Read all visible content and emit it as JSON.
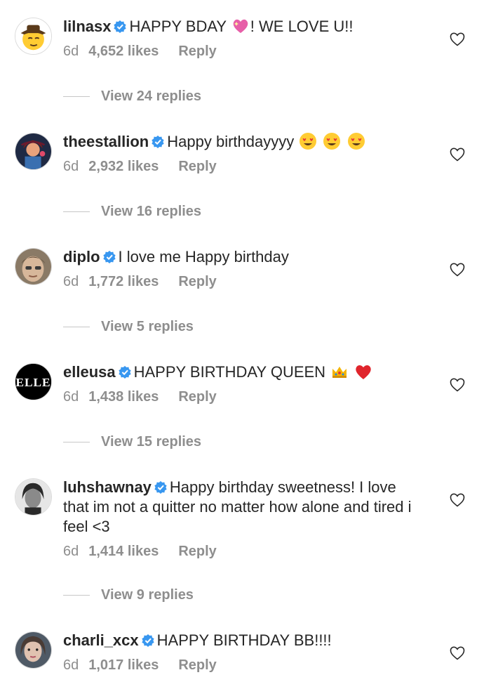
{
  "comments": [
    {
      "username": "lilnasx",
      "text": "HAPPY BDAY",
      "emoji_after": [
        "sparkling-heart"
      ],
      "text_tail": "! WE LOVE U!!",
      "time": "6d",
      "likes": "4,652 likes",
      "reply_label": "Reply",
      "replies_label": "View 24 replies"
    },
    {
      "username": "theestallion",
      "text": "Happy birthdayyyy",
      "emoji_after": [
        "heart-eyes",
        "heart-eyes",
        "heart-eyes"
      ],
      "text_tail": "",
      "time": "6d",
      "likes": "2,932 likes",
      "reply_label": "Reply",
      "replies_label": "View 16 replies"
    },
    {
      "username": "diplo",
      "text": "I love me Happy birthday",
      "emoji_after": [],
      "text_tail": "",
      "time": "6d",
      "likes": "1,772 likes",
      "reply_label": "Reply",
      "replies_label": "View 5 replies"
    },
    {
      "username": "elleusa",
      "text": "HAPPY BIRTHDAY QUEEN",
      "emoji_after": [
        "crown",
        "red-heart"
      ],
      "text_tail": "",
      "time": "6d",
      "likes": "1,438 likes",
      "reply_label": "Reply",
      "replies_label": "View 15 replies",
      "avatar_text": "ELLE"
    },
    {
      "username": "luhshawnay",
      "text": "Happy birthday sweetness! I love that im not a quitter no matter how alone and tired i feel <3",
      "emoji_after": [],
      "text_tail": "",
      "time": "6d",
      "likes": "1,414 likes",
      "reply_label": "Reply",
      "replies_label": "View 9 replies"
    },
    {
      "username": "charli_xcx",
      "text": "HAPPY BIRTHDAY BB!!!!",
      "emoji_after": [],
      "text_tail": "",
      "time": "6d",
      "likes": "1,017 likes",
      "reply_label": "Reply"
    }
  ],
  "colors": {
    "text": "#262626",
    "muted": "#8e8e8e",
    "verified": "#3897f0"
  }
}
